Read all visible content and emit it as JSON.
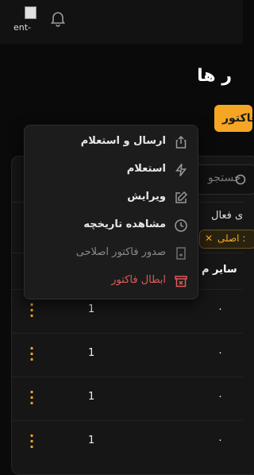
{
  "header": {
    "logo_alt": "ent-"
  },
  "page": {
    "title": "ر ها",
    "primary_button": "فاکتور"
  },
  "search": {
    "placeholder": "جستجو"
  },
  "filter": {
    "label": "ی فعال",
    "chip": ": اصلی"
  },
  "table": {
    "column_header": "سایر م",
    "rows": [
      {
        "count": "1",
        "value": "۰"
      },
      {
        "count": "1",
        "value": "۰"
      },
      {
        "count": "1",
        "value": "۰"
      },
      {
        "count": "1",
        "value": "۰"
      }
    ]
  },
  "menu": {
    "items": [
      {
        "label": "ارسال و استعلام",
        "icon": "share-icon"
      },
      {
        "label": "استعلام",
        "icon": "lightning-icon"
      },
      {
        "label": "ویرایش",
        "icon": "edit-icon"
      },
      {
        "label": "مشاهده تاریخچه",
        "icon": "clock-icon"
      },
      {
        "label": "صدور فاکتور اصلاحی",
        "icon": "corrective-invoice-icon",
        "disabled": true
      },
      {
        "label": "ابطال فاکتور",
        "icon": "cancel-invoice-icon",
        "danger": true
      }
    ]
  },
  "colors": {
    "accent": "#f5a623",
    "danger": "#e05a5a",
    "disabled": "#8a8a8a",
    "background": "#0a0a0a"
  }
}
